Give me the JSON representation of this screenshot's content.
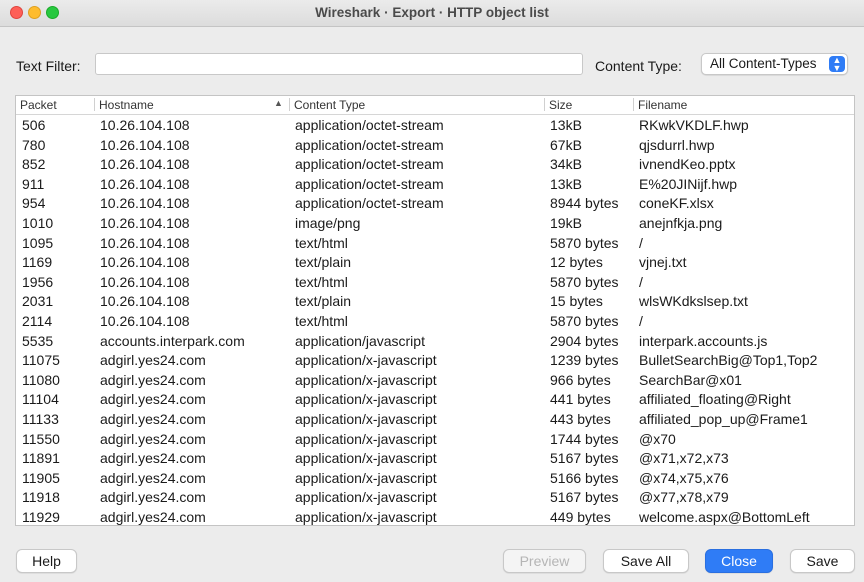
{
  "window": {
    "title": "Wireshark · Export · HTTP object list"
  },
  "filter": {
    "text_filter_label": "Text Filter:",
    "text_filter_value": "",
    "content_type_label": "Content Type:",
    "content_type_value": "All Content-Types"
  },
  "table": {
    "columns": [
      "Packet",
      "Hostname",
      "Content Type",
      "Size",
      "Filename"
    ],
    "sorted_column": "Hostname",
    "rows": [
      [
        "506",
        "10.26.104.108",
        "application/octet-stream",
        "13kB",
        "RKwkVKDLF.hwp"
      ],
      [
        "780",
        "10.26.104.108",
        "application/octet-stream",
        "67kB",
        "qjsdurrl.hwp"
      ],
      [
        "852",
        "10.26.104.108",
        "application/octet-stream",
        "34kB",
        "ivnendKeo.pptx"
      ],
      [
        "911",
        "10.26.104.108",
        "application/octet-stream",
        "13kB",
        "E%20JINijf.hwp"
      ],
      [
        "954",
        "10.26.104.108",
        "application/octet-stream",
        "8944 bytes",
        "coneKF.xlsx"
      ],
      [
        "1010",
        "10.26.104.108",
        "image/png",
        "19kB",
        "anejnfkja.png"
      ],
      [
        "1095",
        "10.26.104.108",
        "text/html",
        "5870 bytes",
        "/"
      ],
      [
        "1169",
        "10.26.104.108",
        "text/plain",
        "12 bytes",
        "vjnej.txt"
      ],
      [
        "1956",
        "10.26.104.108",
        "text/html",
        "5870 bytes",
        "/"
      ],
      [
        "2031",
        "10.26.104.108",
        "text/plain",
        "15 bytes",
        "wlsWKdkslsep.txt"
      ],
      [
        "2114",
        "10.26.104.108",
        "text/html",
        "5870 bytes",
        "/"
      ],
      [
        "5535",
        "accounts.interpark.com",
        "application/javascript",
        "2904 bytes",
        "interpark.accounts.js"
      ],
      [
        "11075",
        "adgirl.yes24.com",
        "application/x-javascript",
        "1239 bytes",
        "BulletSearchBig@Top1,Top2"
      ],
      [
        "11080",
        "adgirl.yes24.com",
        "application/x-javascript",
        "966 bytes",
        "SearchBar@x01"
      ],
      [
        "11104",
        "adgirl.yes24.com",
        "application/x-javascript",
        "441 bytes",
        "affiliated_floating@Right"
      ],
      [
        "11133",
        "adgirl.yes24.com",
        "application/x-javascript",
        "443 bytes",
        "affiliated_pop_up@Frame1"
      ],
      [
        "11550",
        "adgirl.yes24.com",
        "application/x-javascript",
        "1744 bytes",
        "@x70"
      ],
      [
        "11891",
        "adgirl.yes24.com",
        "application/x-javascript",
        "5167 bytes",
        "@x71,x72,x73"
      ],
      [
        "11905",
        "adgirl.yes24.com",
        "application/x-javascript",
        "5166 bytes",
        "@x74,x75,x76"
      ],
      [
        "11918",
        "adgirl.yes24.com",
        "application/x-javascript",
        "5167 bytes",
        "@x77,x78,x79"
      ],
      [
        "11929",
        "adgirl.yes24.com",
        "application/x-javascript",
        "449 bytes",
        "welcome.aspx@BottomLeft"
      ]
    ]
  },
  "buttons": {
    "help": "Help",
    "preview": "Preview",
    "save_all": "Save All",
    "close": "Close",
    "save": "Save"
  },
  "colors": {
    "accent": "#2f7cf6",
    "close_dot": "#fe5f57",
    "min_dot": "#febc2e",
    "max_dot": "#28c840"
  }
}
